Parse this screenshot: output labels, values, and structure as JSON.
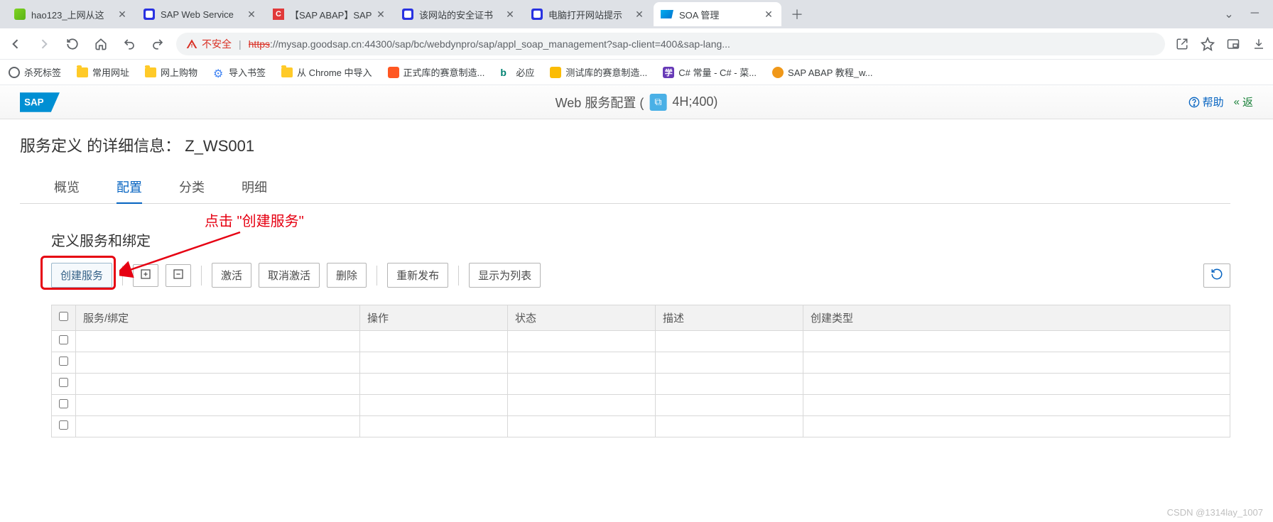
{
  "browser": {
    "tabs": [
      {
        "title": "hao123_上网从这"
      },
      {
        "title": "SAP Web Service"
      },
      {
        "title": "【SAP ABAP】SAP"
      },
      {
        "title": "该网站的安全证书"
      },
      {
        "title": "电脑打开网站提示"
      },
      {
        "title": "SOA 管理"
      }
    ],
    "url_warning": "不安全",
    "url_scheme": "https",
    "url_rest": "://mysap.goodsap.cn:44300/sap/bc/webdynpro/sap/appl_soap_management?sap-client=400&sap-lang..."
  },
  "bookmarks": [
    "杀死标签",
    "常用网址",
    "网上购物",
    "导入书签",
    "从 Chrome 中导入",
    "正式库的赛意制造...",
    "必应",
    "测试库的赛意制造...",
    "C# 常量 - C# - 菜...",
    "SAP ABAP 教程_w..."
  ],
  "sap": {
    "title_left": "Web 服务配置 (",
    "title_right": "4H;400)",
    "help": "帮助",
    "back": "返"
  },
  "page": {
    "heading_prefix": "服务定义 的详细信息：",
    "heading_value": "Z_WS001",
    "tabs": [
      "概览",
      "配置",
      "分类",
      "明细"
    ],
    "active_tab": "配置"
  },
  "section": {
    "title": "定义服务和绑定",
    "annotation": "点击 \"创建服务\""
  },
  "toolbar": {
    "create": "创建服务",
    "activate": "激活",
    "deactivate": "取消激活",
    "delete": "删除",
    "republish": "重新发布",
    "show_as_list": "显示为列表"
  },
  "table": {
    "columns": [
      "服务/绑定",
      "操作",
      "状态",
      "描述",
      "创建类型"
    ]
  },
  "watermark": "CSDN @1314lay_1007"
}
